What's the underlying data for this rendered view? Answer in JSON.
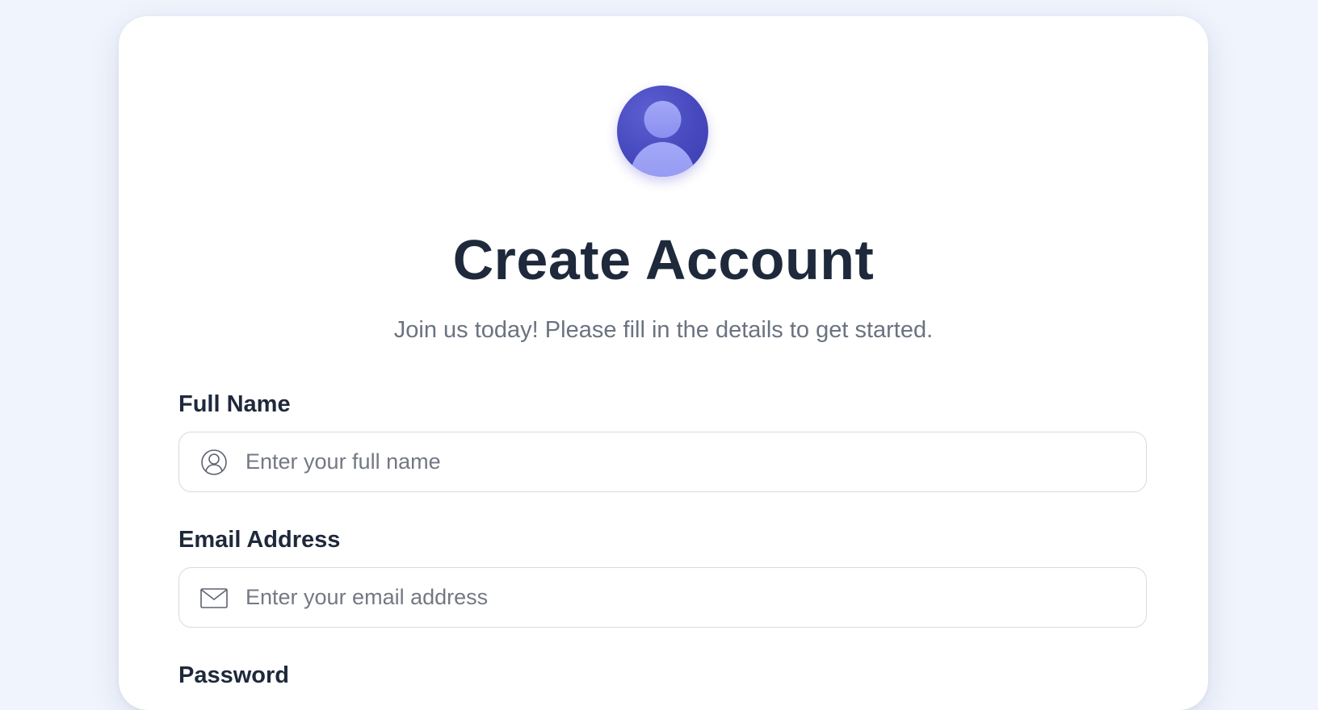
{
  "header": {
    "title": "Create Account",
    "subtitle": "Join us today! Please fill in the details to get started."
  },
  "form": {
    "full_name": {
      "label": "Full Name",
      "placeholder": "Enter your full name",
      "value": "",
      "icon": "user-icon"
    },
    "email": {
      "label": "Email Address",
      "placeholder": "Enter your email address",
      "value": "",
      "icon": "mail-icon"
    },
    "password": {
      "label": "Password"
    }
  },
  "colors": {
    "page_background": "#eff4fd",
    "card_background": "#ffffff",
    "avatar_primary": "#4649bd",
    "avatar_figure": "#9aa0f5",
    "heading": "#1e293b",
    "muted_text": "#6b7280",
    "border": "#d6dae1"
  }
}
